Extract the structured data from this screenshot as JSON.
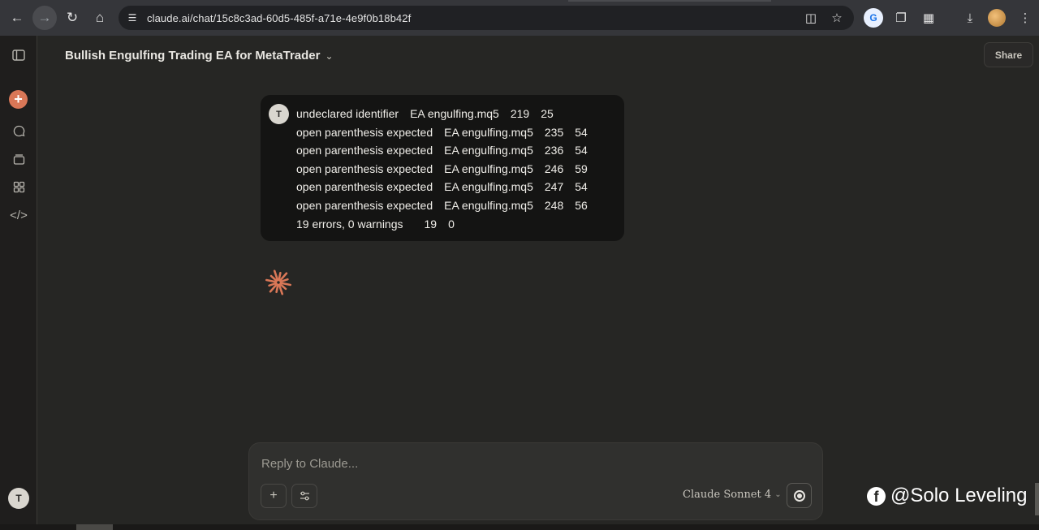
{
  "browser": {
    "url": "claude.ai/chat/15c8c3ad-60d5-485f-a71e-4e9f0b18b42f",
    "icons": [
      "back-icon",
      "forward-icon",
      "reload-icon",
      "home-icon",
      "site-settings-icon",
      "install-app-icon",
      "bookmark-star-icon",
      "translate-extension-icon",
      "extension-icon",
      "puzzle-icon",
      "download-icon",
      "profile-avatar",
      "kebab-menu-icon"
    ]
  },
  "header": {
    "title": "Bullish Engulfing Trading EA for MetaTrader",
    "share_label": "Share"
  },
  "sidebar": {
    "user_initial": "T",
    "icons": [
      "sidebar-toggle-icon",
      "new-chat-icon",
      "chats-icon",
      "projects-icon",
      "artifacts-icon",
      "code-icon"
    ]
  },
  "message": {
    "user_initial": "T",
    "lines": [
      {
        "desc": "undeclared identifier",
        "file": "EA engulfing.mq5",
        "line": "219",
        "col": "25"
      },
      {
        "desc": "open parenthesis expected",
        "file": "EA engulfing.mq5",
        "line": "235",
        "col": "54"
      },
      {
        "desc": "open parenthesis expected",
        "file": "EA engulfing.mq5",
        "line": "236",
        "col": "54"
      },
      {
        "desc": "open parenthesis expected",
        "file": "EA engulfing.mq5",
        "line": "246",
        "col": "59"
      },
      {
        "desc": "open parenthesis expected",
        "file": "EA engulfing.mq5",
        "line": "247",
        "col": "54"
      },
      {
        "desc": "open parenthesis expected",
        "file": "EA engulfing.mq5",
        "line": "248",
        "col": "56"
      },
      {
        "desc": "19 errors, 0 warnings",
        "file": "",
        "line": "19",
        "col": "0"
      }
    ]
  },
  "composer": {
    "placeholder": "Reply to Claude...",
    "model": "Claude Sonnet 4"
  },
  "watermark": "@Solo Leveling",
  "colors": {
    "accent": "#d97757",
    "background": "#262624",
    "bubble": "#141413"
  }
}
